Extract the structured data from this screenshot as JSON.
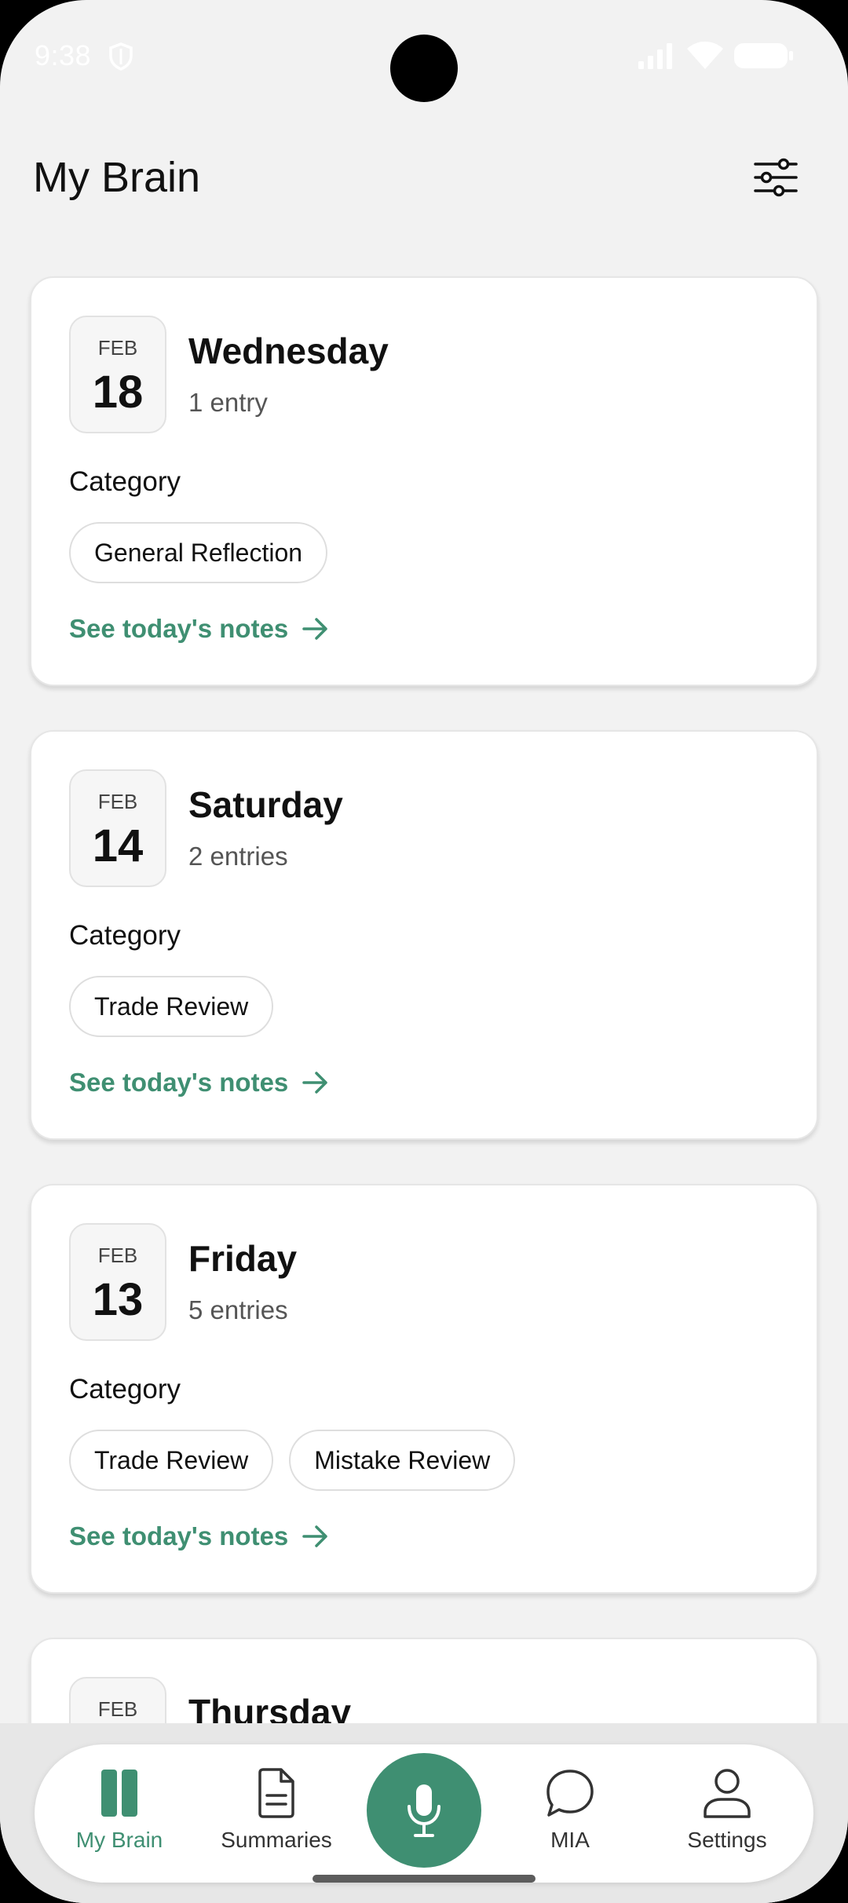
{
  "status_bar": {
    "time": "9:38",
    "icons": [
      "shield-icon",
      "signal-icon",
      "wifi-icon",
      "battery-icon"
    ]
  },
  "header": {
    "title": "My Brain",
    "filter_icon": "sliders-icon"
  },
  "cards": [
    {
      "month": "FEB",
      "day": "18",
      "weekday": "Wednesday",
      "entries": "1 entry",
      "category_label": "Category",
      "categories": [
        "General Reflection"
      ],
      "link_label": "See today's notes"
    },
    {
      "month": "FEB",
      "day": "14",
      "weekday": "Saturday",
      "entries": "2 entries",
      "category_label": "Category",
      "categories": [
        "Trade Review"
      ],
      "link_label": "See today's notes"
    },
    {
      "month": "FEB",
      "day": "13",
      "weekday": "Friday",
      "entries": "5 entries",
      "category_label": "Category",
      "categories": [
        "Trade Review",
        "Mistake Review"
      ],
      "link_label": "See today's notes"
    },
    {
      "month": "FEB",
      "weekday": "Thursday"
    }
  ],
  "bottom_nav": {
    "items": [
      {
        "label": "My Brain",
        "icon": "brain-book-icon",
        "active": true
      },
      {
        "label": "Summaries",
        "icon": "document-icon",
        "active": false
      },
      {
        "label": "MIA",
        "icon": "chat-bubble-icon",
        "active": false
      },
      {
        "label": "Settings",
        "icon": "person-icon",
        "active": false
      }
    ],
    "record_icon": "microphone-icon"
  },
  "colors": {
    "accent": "#3f8f72",
    "background": "#f2f2f2",
    "card": "#ffffff"
  }
}
